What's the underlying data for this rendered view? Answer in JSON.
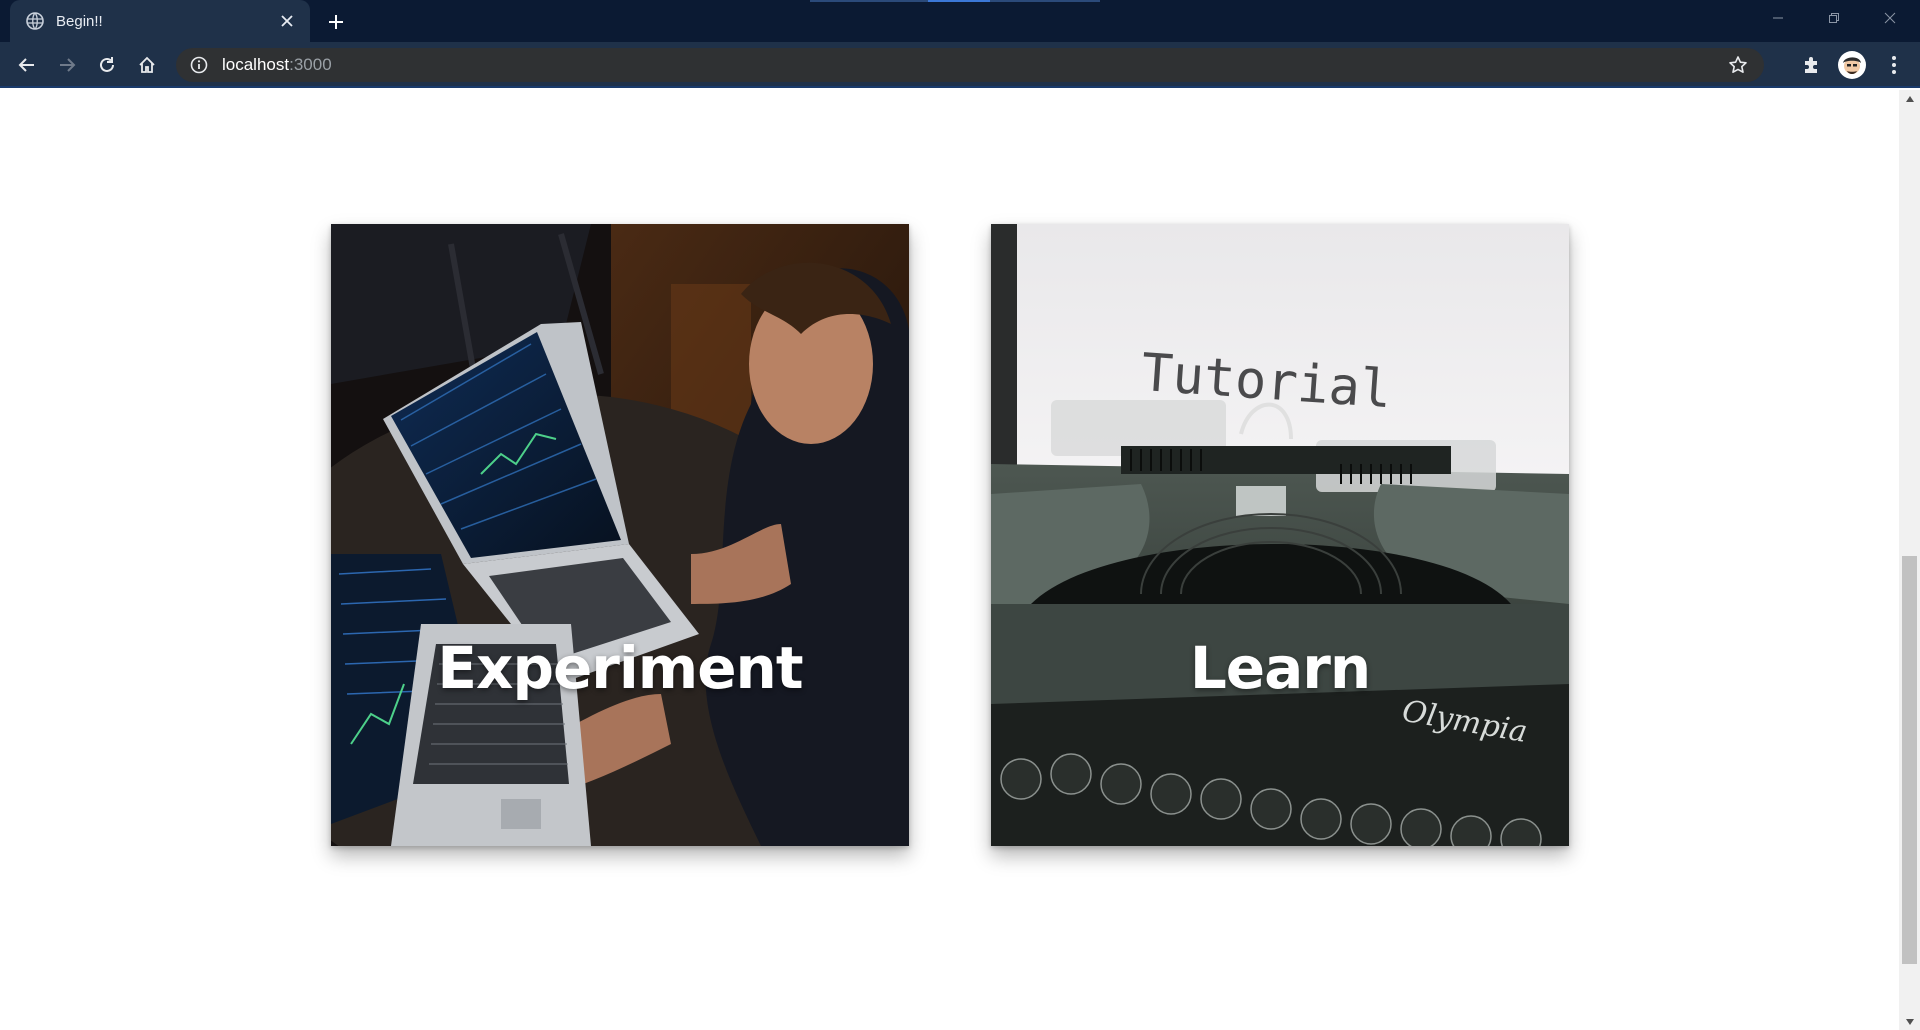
{
  "browser": {
    "tab_title": "Begin!!",
    "url_host": "localhost",
    "url_port": ":3000",
    "icons": {
      "tab": "globe-icon",
      "close": "close-icon",
      "new_tab": "plus-icon",
      "back": "back-arrow-icon",
      "forward": "forward-arrow-icon",
      "reload": "reload-icon",
      "home": "home-icon",
      "site_info": "info-icon",
      "bookmark": "star-icon",
      "extensions": "puzzle-icon",
      "menu": "kebab-menu-icon",
      "minimize": "minimize-icon",
      "restore": "restore-icon",
      "window_close": "window-close-icon"
    },
    "colors": {
      "frame": "#0b1a33",
      "toolbar": "#1f3149",
      "omnibox": "#2f3133"
    }
  },
  "cards": [
    {
      "label": "Experiment",
      "image": "person working on laptops showing stock charts"
    },
    {
      "label": "Learn",
      "image": "typewriter with paper reading Tutorial"
    }
  ],
  "images": {
    "paper_text": "Tutorial",
    "brand_text": "Olympia"
  }
}
